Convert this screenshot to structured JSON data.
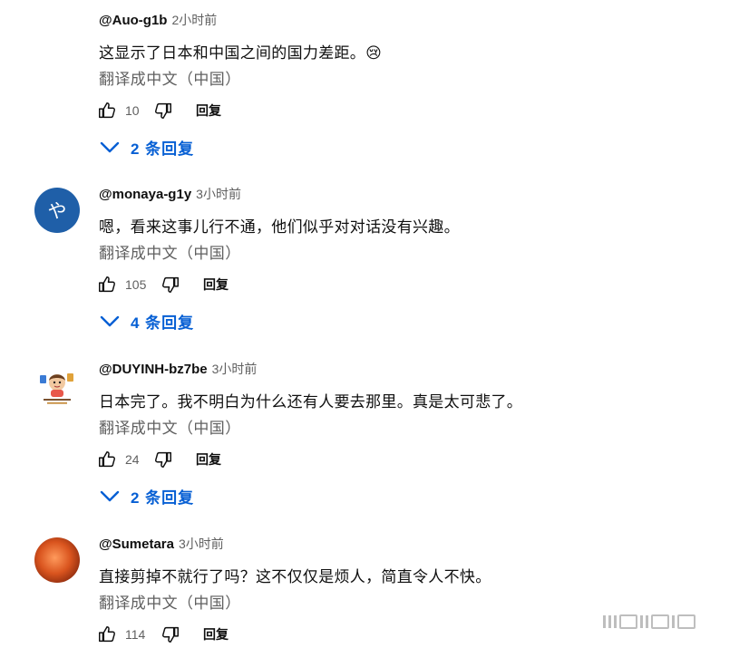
{
  "comments": [
    {
      "author": "@Auo-g1b",
      "time": "2小时前",
      "text": "这显示了日本和中国之间的国力差距。😢",
      "translate": "翻译成中文（中国）",
      "likes": "10",
      "reply_label": "回复",
      "replies": "2 条回复",
      "avatar": "blank"
    },
    {
      "author": "@monaya-g1y",
      "time": "3小时前",
      "text": "嗯，看来这事儿行不通，他们似乎对对话没有兴趣。",
      "translate": "翻译成中文（中国）",
      "likes": "105",
      "reply_label": "回复",
      "replies": "4 条回复",
      "avatar": "letter",
      "avatar_letter": "や",
      "avatar_color": "#1f5fa8"
    },
    {
      "author": "@DUYINH-bz7be",
      "time": "3小时前",
      "text": "日本完了。我不明白为什么还有人要去那里。真是太可悲了。",
      "translate": "翻译成中文（中国）",
      "likes": "24",
      "reply_label": "回复",
      "replies": "2 条回复",
      "avatar": "cartoon"
    },
    {
      "author": "@Sumetara",
      "time": "3小时前",
      "text": "直接剪掉不就行了吗？这不仅仅是烦人，简直令人不快。",
      "translate": "翻译成中文（中国）",
      "likes": "114",
      "reply_label": "回复",
      "avatar": "orange"
    }
  ],
  "colors": {
    "link": "#065fd4",
    "secondary": "#606060",
    "primary": "#0f0f0f"
  },
  "icons": {
    "like": "thumbs-up-icon",
    "dislike": "thumbs-down-icon",
    "expand": "chevron-down-icon"
  }
}
